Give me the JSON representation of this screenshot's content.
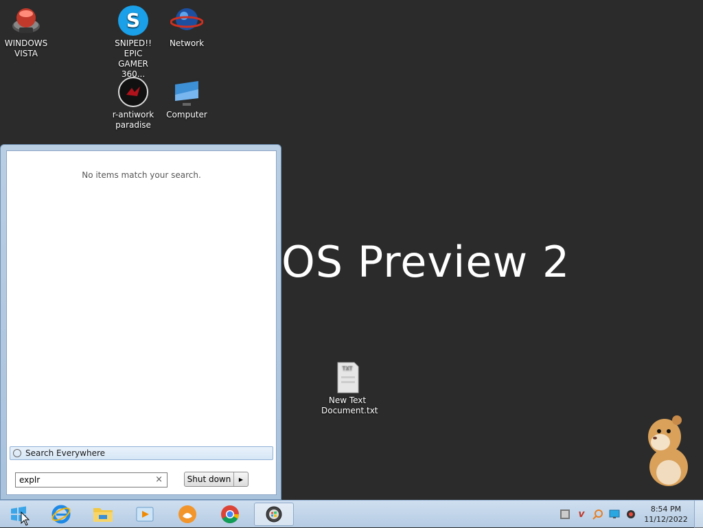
{
  "wallpaper": {
    "text": "OS Preview 2"
  },
  "desktop_icons": {
    "windows_vista": "WINDOWS\nVISTA",
    "sniped": "SNIPED!! EPIC\nGAMER 360...",
    "network": "Network",
    "antiwork": "r-antiwork\nparadise",
    "computer": "Computer",
    "text_doc": "New Text\nDocument.txt"
  },
  "start_menu": {
    "no_items": "No items match your search.",
    "search_everywhere": "Search Everywhere",
    "search_value": "explr",
    "clear_symbol": "×",
    "shutdown_label": "Shut down",
    "shutdown_arrow": "▶"
  },
  "taskbar": {
    "pinned": [
      "internet-explorer",
      "file-explorer",
      "media-player",
      "uc-browser",
      "chrome",
      "active-app"
    ]
  },
  "tray": {
    "time": "8:54 PM",
    "date": "11/12/2022"
  },
  "colors": {
    "desktop_bg": "#2b2b2b",
    "taskbar_bg": "#c3d6ec"
  }
}
